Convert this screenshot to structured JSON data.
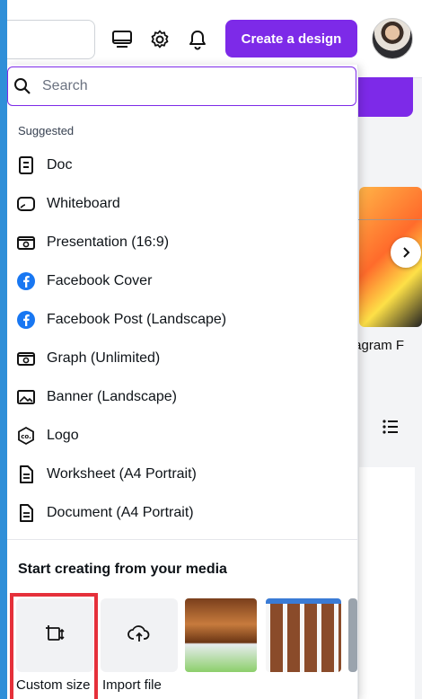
{
  "header": {
    "create_label": "Create a design",
    "icons": [
      "monitor-icon",
      "gear-icon",
      "bell-icon"
    ]
  },
  "background": {
    "card_label": "tagram F",
    "accent": "#7d2ae8"
  },
  "search": {
    "placeholder": "Search"
  },
  "suggested": {
    "title": "Suggested",
    "items": [
      {
        "label": "Doc",
        "icon": "doc-icon"
      },
      {
        "label": "Whiteboard",
        "icon": "whiteboard-icon"
      },
      {
        "label": "Presentation (16:9)",
        "icon": "presentation-icon"
      },
      {
        "label": "Facebook Cover",
        "icon": "facebook-icon"
      },
      {
        "label": "Facebook Post (Landscape)",
        "icon": "facebook-icon"
      },
      {
        "label": "Graph (Unlimited)",
        "icon": "graph-icon"
      },
      {
        "label": "Banner (Landscape)",
        "icon": "image-icon"
      },
      {
        "label": "Logo",
        "icon": "logo-icon"
      },
      {
        "label": "Worksheet (A4 Portrait)",
        "icon": "document-icon"
      },
      {
        "label": "Document (A4 Portrait)",
        "icon": "document-icon"
      }
    ]
  },
  "media": {
    "title": "Start creating from your media",
    "custom_size_label": "Custom size",
    "import_label": "Import file"
  }
}
